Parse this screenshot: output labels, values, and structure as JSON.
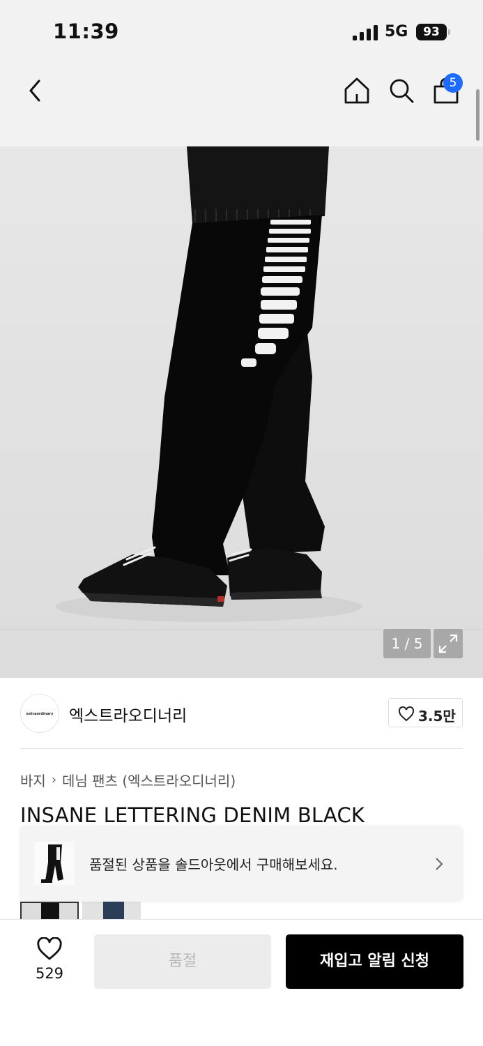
{
  "status_bar": {
    "time": "11:39",
    "network": "5G",
    "battery": "93"
  },
  "nav": {
    "cart_count": "5"
  },
  "gallery": {
    "counter": "1 / 5"
  },
  "brand": {
    "logo_text": "extraordinary",
    "name": "엑스트라오디너리",
    "likes": "3.5만"
  },
  "breadcrumb": {
    "items": [
      "바지",
      "데님 팬츠 (엑스트라오디너리)"
    ]
  },
  "product": {
    "title": "INSANE LETTERING DENIM BLACK"
  },
  "soldout_banner": {
    "text": "품절된 상품을 솔드아웃에서 구매해보세요."
  },
  "bottom_bar": {
    "wish_count": "529",
    "soldout_label": "품절",
    "restock_label": "재입고 알림 신청"
  },
  "colors": {
    "badge": "#1e6bff",
    "primary_button": "#000000",
    "disabled_button": "#ececec"
  }
}
